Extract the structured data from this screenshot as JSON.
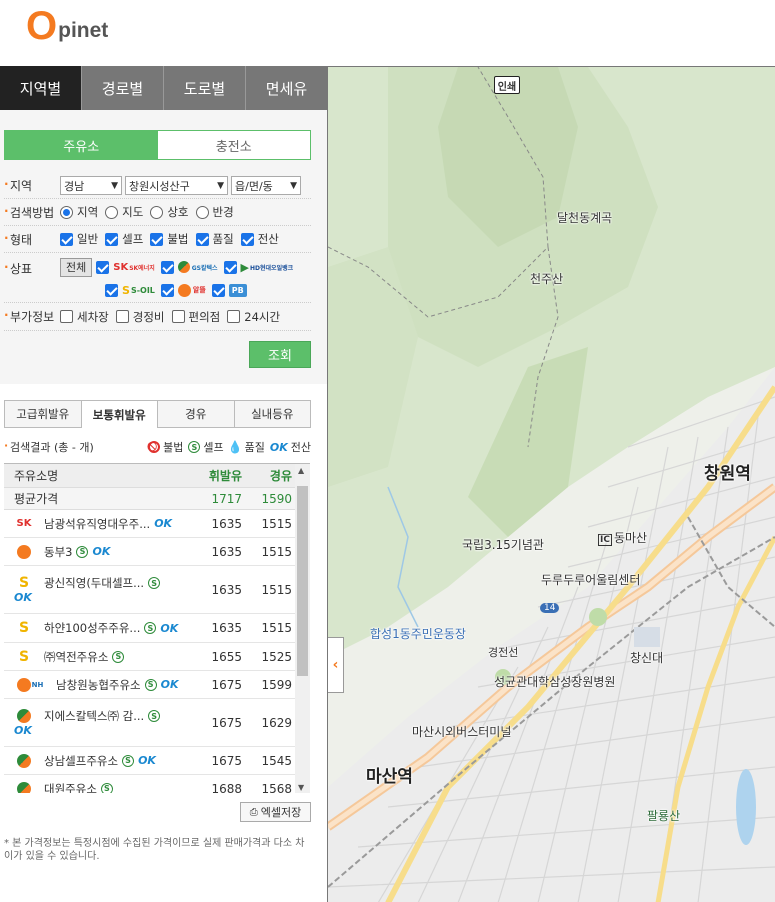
{
  "logo": {
    "first": "O",
    "rest": "pinet"
  },
  "main_tabs": [
    {
      "label": "지역별",
      "active": true
    },
    {
      "label": "경로별",
      "active": false
    },
    {
      "label": "도로별",
      "active": false
    },
    {
      "label": "면세유",
      "active": false
    }
  ],
  "station_tabs": [
    {
      "label": "주유소",
      "active": true
    },
    {
      "label": "충전소",
      "active": false
    }
  ],
  "filters": {
    "region": {
      "label": "지역",
      "sido": "경남",
      "sigungu": "창원시성산구",
      "dong": "읍/면/동"
    },
    "method": {
      "label": "검색방법",
      "options": [
        "지역",
        "지도",
        "상호",
        "반경"
      ],
      "selected": "지역"
    },
    "type": {
      "label": "형태",
      "options": [
        "일반",
        "셀프",
        "불법",
        "품질",
        "전산"
      ]
    },
    "brand": {
      "label": "상표",
      "all_button": "전체",
      "row1": [
        "SK에너지",
        "GS칼텍스",
        "HD현대오일뱅크"
      ],
      "row2": [
        "S-OIL",
        "알뜰",
        "PB"
      ]
    },
    "extra": {
      "label": "부가정보",
      "options": [
        "세차장",
        "경정비",
        "편의점",
        "24시간"
      ]
    }
  },
  "search_button": "조회",
  "fuel_tabs": [
    {
      "label": "고급휘발유",
      "active": false
    },
    {
      "label": "보통휘발유",
      "active": true
    },
    {
      "label": "경유",
      "active": false
    },
    {
      "label": "실내등유",
      "active": false
    }
  ],
  "result": {
    "count_text": "검색결과 (총 - 개)",
    "legend": [
      {
        "label": "불법",
        "icon": "prohibit-icon",
        "color": "#e0312e"
      },
      {
        "label": "셀프",
        "icon": "self-icon",
        "color": "#2e8b3a"
      },
      {
        "label": "품질",
        "icon": "drop-icon",
        "color": "#1a88d0"
      },
      {
        "label": "전산",
        "icon": "ok-icon",
        "color": "#1a88d0"
      }
    ]
  },
  "table": {
    "headers": {
      "name": "주유소명",
      "gasoline": "휘발유",
      "diesel": "경유"
    },
    "average": {
      "label": "평균가격",
      "gasoline": "1717",
      "diesel": "1590"
    },
    "rows": [
      {
        "brand": "SK",
        "name": "남광석유직영대우주...",
        "gasoline": "1635",
        "diesel": "1515"
      },
      {
        "brand": "알뜰",
        "name": "동부3",
        "gasoline": "1635",
        "diesel": "1515"
      },
      {
        "brand": "S-OIL",
        "name": "광신직영(두대셀프...",
        "gasoline": "1635",
        "diesel": "1515"
      },
      {
        "brand": "S-OIL",
        "name": "하얀100성주주유...",
        "gasoline": "1635",
        "diesel": "1515"
      },
      {
        "brand": "S-OIL",
        "name": "㈜역전주유소",
        "gasoline": "1655",
        "diesel": "1525"
      },
      {
        "brand": "NH",
        "name": "남창원농협주유소",
        "gasoline": "1675",
        "diesel": "1599"
      },
      {
        "brand": "GS",
        "name": "지에스칼텍스㈜ 감...",
        "gasoline": "1675",
        "diesel": "1629"
      },
      {
        "brand": "GS",
        "name": "상남셀프주유소",
        "gasoline": "1675",
        "diesel": "1545"
      },
      {
        "brand": "GS",
        "name": "대원주유소",
        "gasoline": "1688",
        "diesel": "1568"
      }
    ]
  },
  "excel_button": "엑셀저장",
  "notice": "* 본 가격정보는 특정시점에 수집된 가격이므로 실제 판매가격과 다소 차이가 있을 수 있습니다.",
  "map": {
    "print_label": "인쇄",
    "labels": [
      {
        "text": "달천동계곡"
      },
      {
        "text": "천주산"
      },
      {
        "text": "창원역"
      },
      {
        "text": "동마산"
      },
      {
        "text": "국립3.15기념관"
      },
      {
        "text": "두루두루어울림센터"
      },
      {
        "text": "합성1동주민운동장"
      },
      {
        "text": "경전선"
      },
      {
        "text": "창신대"
      },
      {
        "text": "성균관대학삼성창원병원"
      },
      {
        "text": "마산시외버스터미널"
      },
      {
        "text": "마산역"
      },
      {
        "text": "팔룡산"
      },
      {
        "text": "14"
      }
    ]
  },
  "colors": {
    "accent": "#f47a20",
    "green": "#5cbf6a",
    "dark_tab": "#222222"
  }
}
